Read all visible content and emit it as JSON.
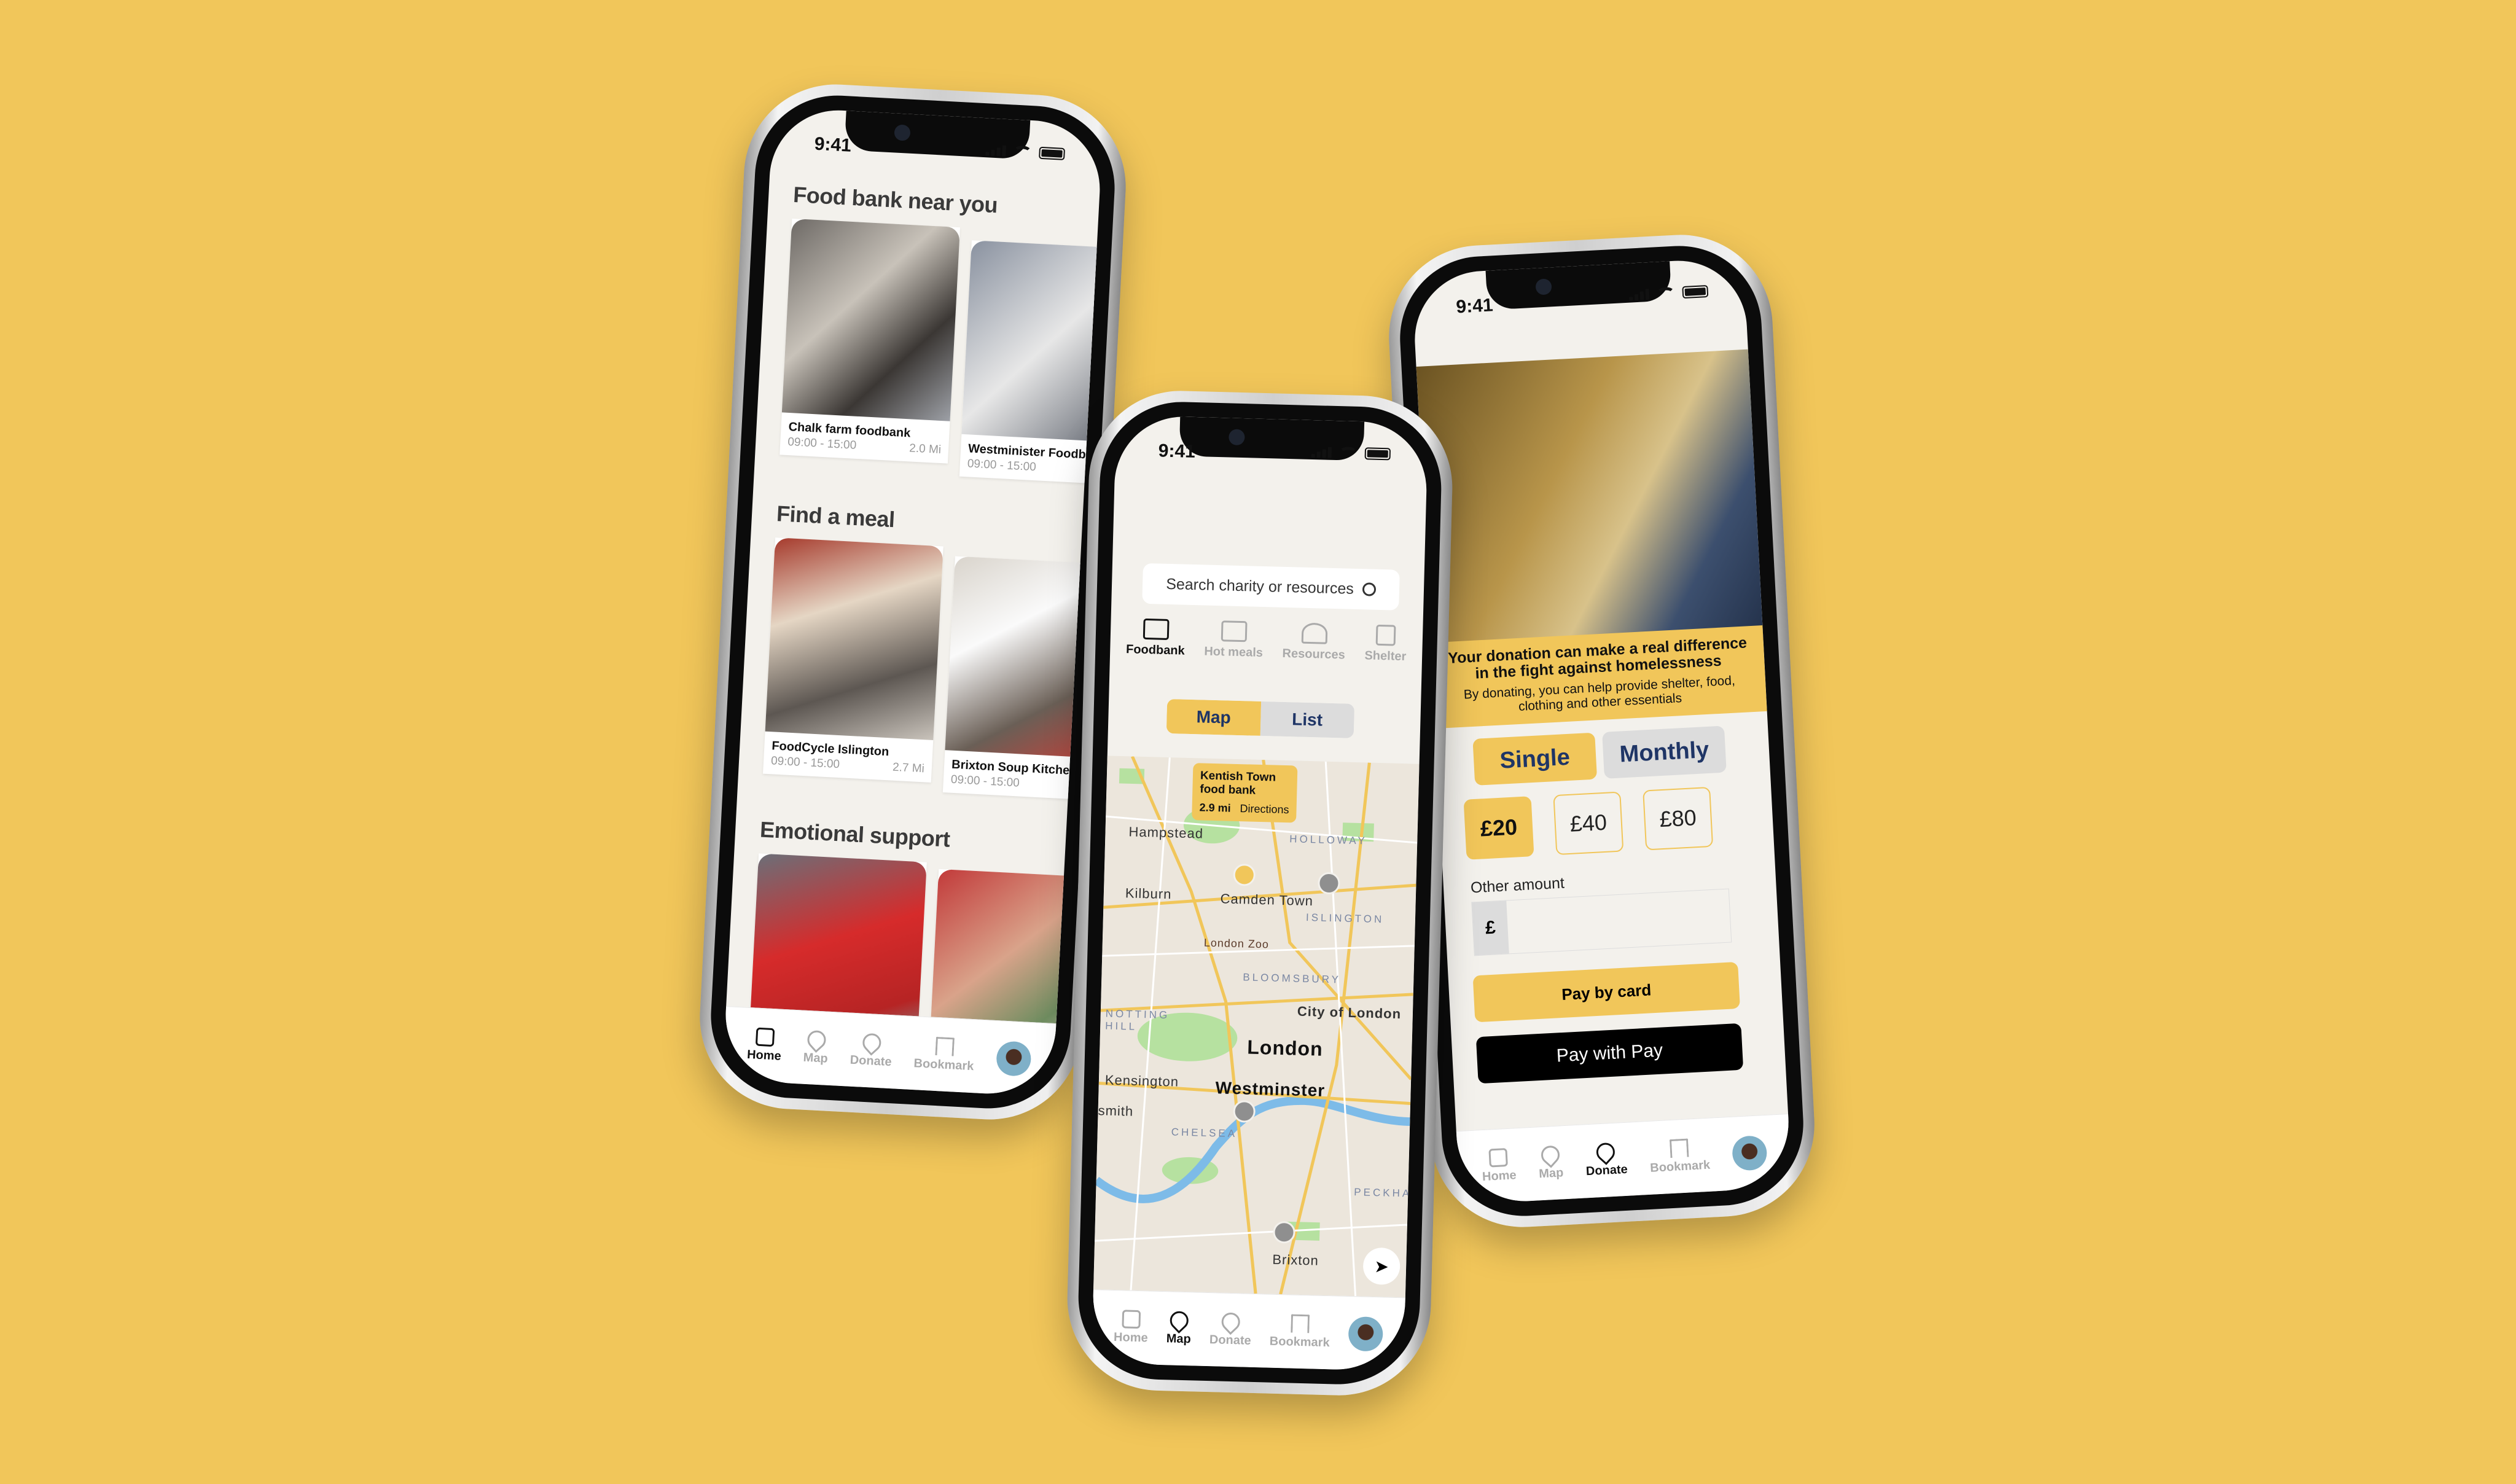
{
  "status": {
    "time": "9:41"
  },
  "home": {
    "sections": [
      {
        "title": "Food bank near you",
        "cards": [
          {
            "name": "Chalk farm foodbank",
            "hours": "09:00 - 15:00",
            "distance": "2.0 Mi"
          },
          {
            "name": "Westminister Foodbank",
            "hours": "09:00 - 15:00",
            "distance": ""
          }
        ]
      },
      {
        "title": "Find a meal",
        "cards": [
          {
            "name": "FoodCycle Islington",
            "hours": "09:00 - 15:00",
            "distance": "2.7 Mi"
          },
          {
            "name": "Brixton Soup Kitchen",
            "hours": "09:00 - 15:00",
            "distance": ""
          }
        ]
      },
      {
        "title": "Emotional support",
        "cards": []
      }
    ]
  },
  "tabbar": {
    "home": "Home",
    "map": "Map",
    "donate": "Donate",
    "bookmark": "Bookmark"
  },
  "map_screen": {
    "search_placeholder": "Search charity or resources",
    "categories": [
      "Foodbank",
      "Hot meals",
      "Resources",
      "Shelter"
    ],
    "toggle": {
      "map": "Map",
      "list": "List"
    },
    "tooltip": {
      "title": "Kentish Town food bank",
      "distance": "2.9 mi",
      "action": "Directions"
    },
    "labels": {
      "hampstead": "Hampstead",
      "holloway": "HOLLOWAY",
      "kilburn": "Kilburn",
      "camden": "Camden Town",
      "islington": "ISLINGTON",
      "zoo": "London Zoo",
      "bloomsbury": "BLOOMSBURY",
      "notting": "NOTTING HILL",
      "city": "City of London",
      "london": "London",
      "kensington": "Kensington",
      "hammersmith": "smith",
      "westminster": "Westminster",
      "chelsea": "CHELSEA",
      "peckham": "PECKHAM",
      "brixton": "Brixton"
    }
  },
  "donate": {
    "headline": "Your donation can make a real difference in the fight against homelessness",
    "subline": "By donating, you can help provide shelter, food, clothing and other essentials",
    "frequency": {
      "single": "Single",
      "monthly": "Monthly"
    },
    "amounts": [
      "£20",
      "£40",
      "£80"
    ],
    "selected_amount": "£20",
    "other_label": "Other amount",
    "currency": "£",
    "other_value": "",
    "pay_card": "Pay by card",
    "pay_apple": "Pay with  Pay"
  },
  "colors": {
    "background": "#f1c65a",
    "accent": "#f1c65a",
    "navy": "#1f3566",
    "screen": "#f3f1ec"
  }
}
